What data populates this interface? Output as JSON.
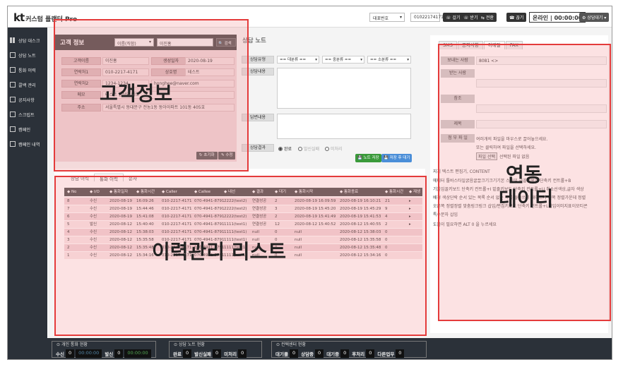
{
  "app": {
    "logo_kt": "kt",
    "logo_product": "커스텀 플랜터 Pro"
  },
  "topbar": {
    "rep_number": "대표번호",
    "phone": "01022174171",
    "buttons": [
      "걸기",
      "받기",
      "전환",
      "끊기"
    ],
    "online": "온라인 | 00:00:00",
    "status_select": "상담대기"
  },
  "sidebar": {
    "items": [
      {
        "label": "상담 대스크",
        "icon": "grid-icon"
      },
      {
        "label": "상담 노트",
        "icon": "edit-icon"
      },
      {
        "label": "통화 이력",
        "icon": "edit-icon"
      },
      {
        "label": "콜백 관리",
        "icon": "edit-icon"
      },
      {
        "label": "공지사항",
        "icon": "edit-icon"
      },
      {
        "label": "스크립트",
        "icon": "edit-icon"
      },
      {
        "label": "캠페인",
        "icon": "edit-icon"
      },
      {
        "label": "캠페인 내역",
        "icon": "edit-icon"
      }
    ]
  },
  "customer": {
    "title": "고객 정보",
    "search_type": "이름(직함)",
    "search_value": "이진홍",
    "search_btn": "검색",
    "fields": {
      "name_label": "고객이름",
      "name": "이진홍",
      "birth_label": "생성일자",
      "birth": "2020-08-19",
      "phone1_label": "연락처1",
      "phone1": "010-2217-4171",
      "company_label": "상호명",
      "company": "테스트",
      "phone2_label": "연락처2",
      "phone2": "1234-1234",
      "email": "honghee@naver.com",
      "memo_label": "메모",
      "memo": "테스트 업상담 메모",
      "addr_label": "주소",
      "addr": "서울특별시 동대문구 전농1동 동아아파트 101동 405호"
    },
    "reset_btn": "초기화",
    "edit_btn": "수정"
  },
  "note": {
    "title": "상담 노트",
    "type_label": "상담유형",
    "selects": [
      "== 대분류 ==",
      "== 중분류 ==",
      "== 소분류 =="
    ],
    "content_label": "상담내용",
    "answer_label": "답변내용",
    "result_label": "상담결과",
    "radios": [
      "완료",
      "발신실패",
      "미처리"
    ],
    "save_btn": "노트 저장",
    "save_wait_btn": "저장 후 대기"
  },
  "right": {
    "tabs": [
      "SMS",
      "공지사항",
      "이메일",
      "FAX"
    ],
    "sender_label": "보내는 사람",
    "sender": "8081 <>",
    "receiver_label": "받는 사람",
    "cc_label": "참조",
    "subject_label": "제목",
    "attach_label": "첨 부 파 일",
    "attach_hint1": "여러개의 파일을 마우스로 끌어놓으세요.",
    "attach_hint2": "또는 클릭하여 파일을 선택하세요.",
    "file_btn": "파일 선택",
    "file_none": "선택된 파일 없음",
    "editor_lines": [
      "지치 텍스트 편집기, CONTENT",
      "에디터 툴바스타일굵음굴끌크기크기기본 스타일 글꼴서체호 단축키 컨트롤+B",
      "기울임꼴키보드 단축키 컨트롤+I 밑줄키보드 단축키 컨트롤+U 취소선색상,글자 색상",
      "배경 색상단락 순서 있는 목록 순서 없는 목록 들여쓰기 내어쓰기 왼쪽 정렬가운데 정렬",
      "오른쪽 정렬정렬 맞춤링크링크 삽입/편집키보드 단축키 컨트롤+L삽입이미지표이모티콘",
      "특수문자 삽입",
      "도움이 필요하면 ALT 0 을 누르세요"
    ]
  },
  "history": {
    "tabs": [
      "상담 이력",
      "통화 이력",
      "문자"
    ],
    "columns": [
      "No",
      "I/O",
      "통화일자",
      "통화시간",
      "Caller",
      "Callee",
      "내선",
      "결과",
      "대기",
      "통화시작",
      "통화종료",
      "통화시간",
      "재생"
    ],
    "rows": [
      [
        "8",
        "수신",
        "2020-08-19",
        "16:09:26",
        "010-2217-4171",
        "070-4941-8791",
        "2222(test2)",
        "연결성공",
        "2",
        "2020-08-19 16:09:59",
        "2020-08-19 16:10:21",
        "21",
        "▸"
      ],
      [
        "7",
        "수신",
        "2020-08-19",
        "15:44:46",
        "010-2217-4171",
        "070-4941-8791",
        "2222(test2)",
        "연결성공",
        "3",
        "2020-08-19 15:45:20",
        "2020-08-19 15:45:29",
        "9",
        "▸"
      ],
      [
        "6",
        "수신",
        "2020-08-19",
        "15:41:08",
        "010-2217-4171",
        "070-4941-8791",
        "2222(test2)",
        "연결성공",
        "2",
        "2020-08-19 15:41:49",
        "2020-08-19 15:41:53",
        "4",
        "▸"
      ],
      [
        "5",
        "발신",
        "2020-08-12",
        "15:40:40",
        "010-2217-4171",
        "070-4941-8791",
        "1111(test1)",
        "연결성공",
        "12",
        "2020-08-12 15:40:52",
        "2020-08-12 15:40:55",
        "2",
        "▸"
      ],
      [
        "4",
        "수신",
        "2020-08-12",
        "15:38:03",
        "010-2217-4171",
        "070-4941-8791",
        "1111(test1)",
        "null",
        "0",
        "null",
        "2020-08-12 15:38:03",
        "0",
        ""
      ],
      [
        "3",
        "수신",
        "2020-08-12",
        "15:35:58",
        "010-2217-4171",
        "070-4941-8791",
        "1111(test1)",
        "null",
        "0",
        "null",
        "2020-08-12 15:35:58",
        "0",
        ""
      ],
      [
        "2",
        "수신",
        "2020-08-12",
        "15:35:48",
        "010-2217-4171",
        "070-4941-8791",
        "1111(test1)",
        "null",
        "0",
        "null",
        "2020-08-12 15:35:48",
        "0",
        ""
      ],
      [
        "1",
        "수신",
        "2020-08-12",
        "15:34:16",
        "010-2217-4171",
        "070-4941-8791",
        "1111(test1)",
        "null",
        "0",
        "null",
        "2020-08-12 15:34:16",
        "0",
        ""
      ]
    ]
  },
  "overlays": {
    "customer": "고객정보",
    "history": "이력관리 리스트",
    "linked_1": "연동",
    "linked_2": "데이터"
  },
  "status": {
    "personal_title": "개인 통화 현황",
    "personal": [
      {
        "label": "수신",
        "value": "0"
      },
      {
        "label": "",
        "value": "00:00:00",
        "style": "time"
      },
      {
        "label": "발신",
        "value": "0"
      },
      {
        "label": "",
        "value": "00:00:00",
        "style": "timeg"
      }
    ],
    "note_title": "상담 노트 현황",
    "note": [
      {
        "label": "완료",
        "value": "0"
      },
      {
        "label": "발신실패",
        "value": "0"
      },
      {
        "label": "미처리",
        "value": "0"
      }
    ],
    "center_title": "컨택센터 현황",
    "center": [
      {
        "label": "대기콜",
        "value": "0"
      },
      {
        "label": "상담중",
        "value": "0"
      },
      {
        "label": "대기중",
        "value": "0"
      },
      {
        "label": "후처리",
        "value": "0"
      },
      {
        "label": "다른업무",
        "value": "0"
      }
    ]
  }
}
